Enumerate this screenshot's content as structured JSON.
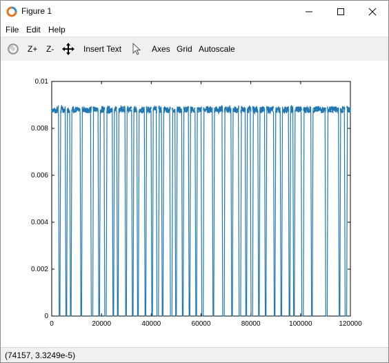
{
  "window": {
    "title": "Figure 1"
  },
  "menu": {
    "items": [
      "File",
      "Edit",
      "Help"
    ]
  },
  "toolbar": {
    "rotate_icon": "rotate-icon",
    "zoom_in_label": "Z+",
    "zoom_out_label": "Z-",
    "pan_icon": "pan-icon",
    "insert_text_label": "Insert Text",
    "select_icon": "cursor-icon",
    "axes_label": "Axes",
    "grid_label": "Grid",
    "autoscale_label": "Autoscale"
  },
  "status": {
    "text": "(74157, 3.3249e-5)"
  },
  "colors": {
    "series": "#1f77b4",
    "toolbar_bg": "#f0f0f0"
  },
  "chart_data": {
    "type": "line",
    "title": "",
    "xlabel": "",
    "ylabel": "",
    "xlim": [
      0,
      120000
    ],
    "ylim": [
      0,
      0.01
    ],
    "xticks": [
      0,
      20000,
      40000,
      60000,
      80000,
      100000,
      120000
    ],
    "xtick_labels": [
      "0",
      "20000",
      "40000",
      "60000",
      "80000",
      "100000",
      "120000"
    ],
    "yticks": [
      0,
      0.002,
      0.004,
      0.006,
      0.008,
      0.01
    ],
    "ytick_labels": [
      "0",
      "0.002",
      "0.004",
      "0.006",
      "0.008",
      "0.01"
    ],
    "grid": false,
    "description_of_series": "pulse train: value ~0.0088-0.0090 (noisy) with brief drops to 0",
    "high_level": 0.0088,
    "drop_positions_x": [
      3200,
      5800,
      7600,
      11800,
      16200,
      19000,
      21600,
      24800,
      26600,
      29800,
      32600,
      34600,
      37600,
      40400,
      42600,
      44600,
      48000,
      50000,
      52600,
      55400,
      58000,
      60600,
      65000,
      69000,
      72400,
      75600,
      78200,
      80400,
      83200,
      86000,
      89600,
      92200,
      95600,
      97400,
      100800,
      104600,
      110400,
      115600,
      118200
    ]
  }
}
